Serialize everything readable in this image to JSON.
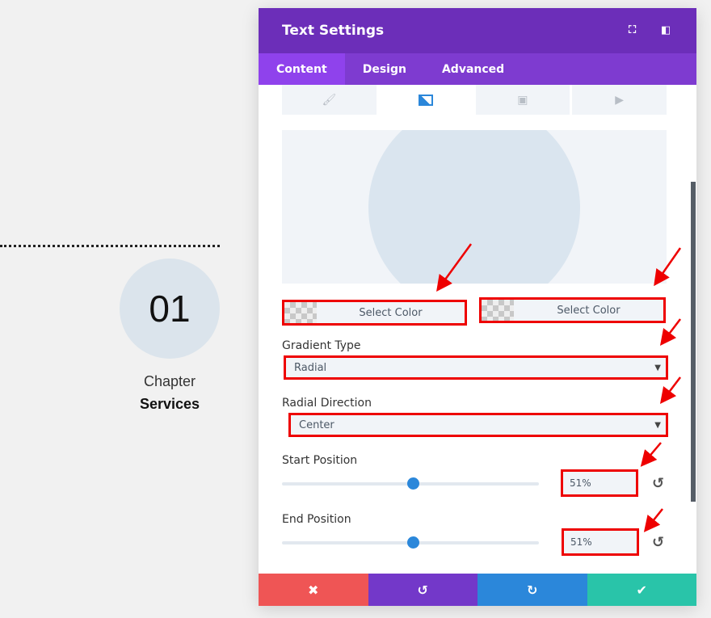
{
  "page": {
    "number": "01",
    "chapter": "Chapter",
    "title": "Services"
  },
  "modal": {
    "title": "Text Settings",
    "header_icons": [
      "fullscreen-icon",
      "sidebar-layout-icon"
    ],
    "tabs": [
      {
        "label": "Content",
        "active": true
      },
      {
        "label": "Design"
      },
      {
        "label": "Advanced"
      }
    ],
    "background_tabs": [
      "paint-bucket-icon",
      "gradient-icon",
      "image-icon",
      "video-icon"
    ],
    "active_background_tab": "gradient",
    "color1_label": "Select Color",
    "color2_label": "Select Color",
    "gradient_type_label": "Gradient Type",
    "gradient_type_value": "Radial",
    "radial_direction_label": "Radial Direction",
    "radial_direction_value": "Center",
    "start_label": "Start Position",
    "start_value": "51%",
    "start_percent": 51,
    "end_label": "End Position",
    "end_value": "51%",
    "end_percent": 51,
    "footer": [
      "close-icon",
      "undo-icon",
      "redo-icon",
      "check-icon"
    ]
  },
  "colors": {
    "header": "#6c2eb9",
    "tabs": "#7e3bd0",
    "accent": "#2b87da",
    "annotation": "#ee0000",
    "cancel": "#ef5555",
    "save": "#29c4a9"
  }
}
